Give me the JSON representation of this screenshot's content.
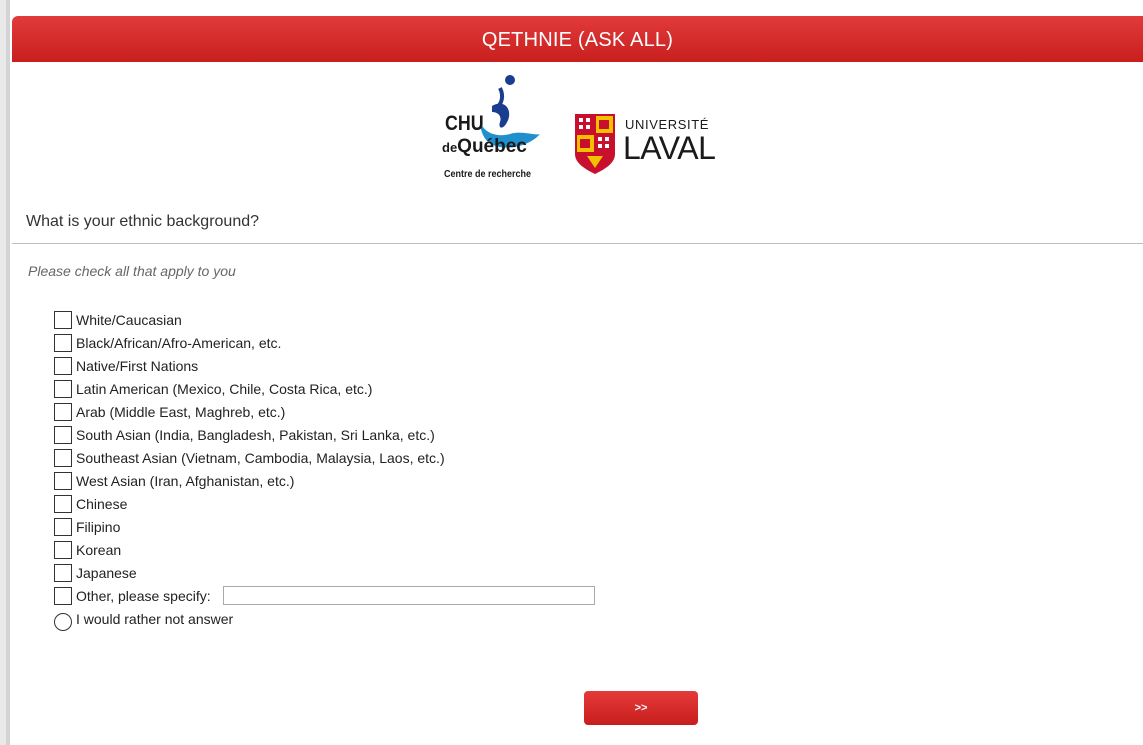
{
  "header": {
    "title": "QETHNIE (ASK ALL)"
  },
  "logos": {
    "chu": {
      "line1": "CHU",
      "line2_prefix": "de",
      "line2": "Québec",
      "line3": "Centre de recherche"
    },
    "laval": {
      "line1": "UNIVERSITÉ",
      "line2": "LAVAL"
    }
  },
  "question": {
    "text": "What is your ethnic background?",
    "instruction": "Please check all that apply to you"
  },
  "options": [
    {
      "label": "White/Caucasian",
      "type": "checkbox",
      "checked": false
    },
    {
      "label": "Black/African/Afro-American, etc.",
      "type": "checkbox",
      "checked": false
    },
    {
      "label": "Native/First Nations",
      "type": "checkbox",
      "checked": false
    },
    {
      "label": "Latin American (Mexico, Chile, Costa Rica, etc.)",
      "type": "checkbox",
      "checked": false
    },
    {
      "label": "Arab (Middle East, Maghreb, etc.)",
      "type": "checkbox",
      "checked": false
    },
    {
      "label": "South Asian (India, Bangladesh, Pakistan, Sri Lanka, etc.)",
      "type": "checkbox",
      "checked": false
    },
    {
      "label": "Southeast Asian (Vietnam, Cambodia, Malaysia, Laos, etc.)",
      "type": "checkbox",
      "checked": false
    },
    {
      "label": "West Asian (Iran, Afghanistan, etc.)",
      "type": "checkbox",
      "checked": false
    },
    {
      "label": "Chinese",
      "type": "checkbox",
      "checked": false
    },
    {
      "label": "Filipino",
      "type": "checkbox",
      "checked": false
    },
    {
      "label": "Korean",
      "type": "checkbox",
      "checked": false
    },
    {
      "label": "Japanese",
      "type": "checkbox",
      "checked": false
    },
    {
      "label": "Other, please specify:",
      "type": "checkbox",
      "checked": false,
      "input_value": ""
    },
    {
      "label": "I would rather not answer",
      "type": "radio",
      "checked": false
    }
  ],
  "navigation": {
    "next_label": ">>"
  },
  "colors": {
    "accent": "#d32a2a",
    "chu_blue": "#1f8fce",
    "chu_navy": "#1b3d8f",
    "laval_red": "#c8102e",
    "laval_gold": "#f2c200"
  }
}
